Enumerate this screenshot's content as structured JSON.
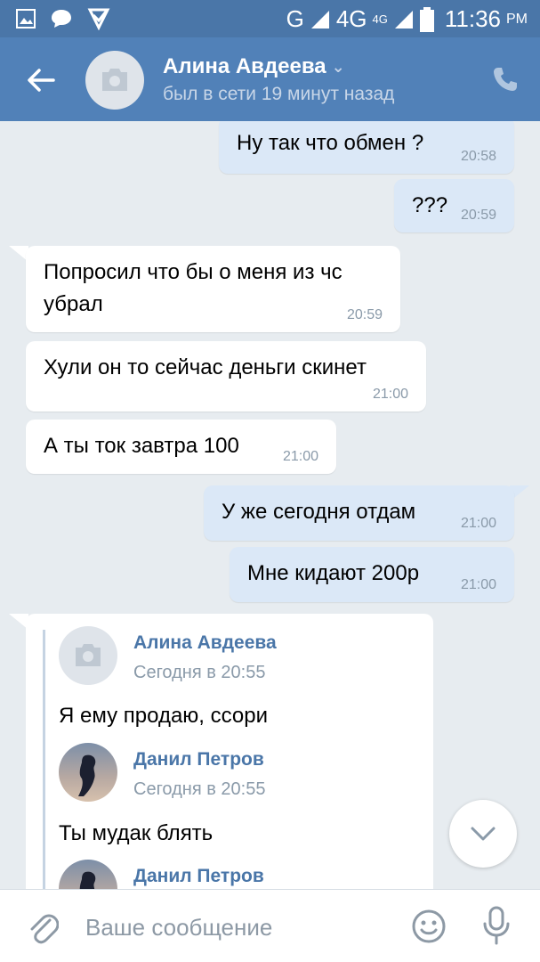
{
  "status_bar": {
    "network": "G",
    "network2": "4G",
    "network2_sup": "4G",
    "time": "11:36",
    "ampm": "PM"
  },
  "header": {
    "name": "Алина Авдеева",
    "status": "был в сети 19 минут назад"
  },
  "messages": [
    {
      "text": "Ну так что обмен ?",
      "time": "20:58"
    },
    {
      "text": "???",
      "time": "20:59"
    },
    {
      "text": "Попросил что бы о меня из чс",
      "text2": "убрал",
      "time": "20:59"
    },
    {
      "text": "Хули он то сейчас деньги скинет",
      "time": "21:00"
    },
    {
      "text": "А ты ток завтра 100",
      "time": "21:00"
    },
    {
      "text": "У же сегодня отдам",
      "time": "21:00"
    },
    {
      "text": "Мне кидают 200р",
      "time": "21:00"
    }
  ],
  "forwarded": [
    {
      "name": "Алина Авдеева",
      "date": "Сегодня в 20:55",
      "text": "Я ему продаю, ссори"
    },
    {
      "name": "Данил Петров",
      "date": "Сегодня в 20:55",
      "text": "Ты мудак блять"
    },
    {
      "name": "Данил Петров"
    }
  ],
  "input": {
    "placeholder": "Ваше сообщение"
  },
  "colors": {
    "header": "#5181b8",
    "status_bar": "#4a76a8",
    "bubble_out": "#dbe8f7",
    "bubble_in": "#ffffff",
    "background": "#e7ecf0",
    "link": "#4a76a8"
  }
}
